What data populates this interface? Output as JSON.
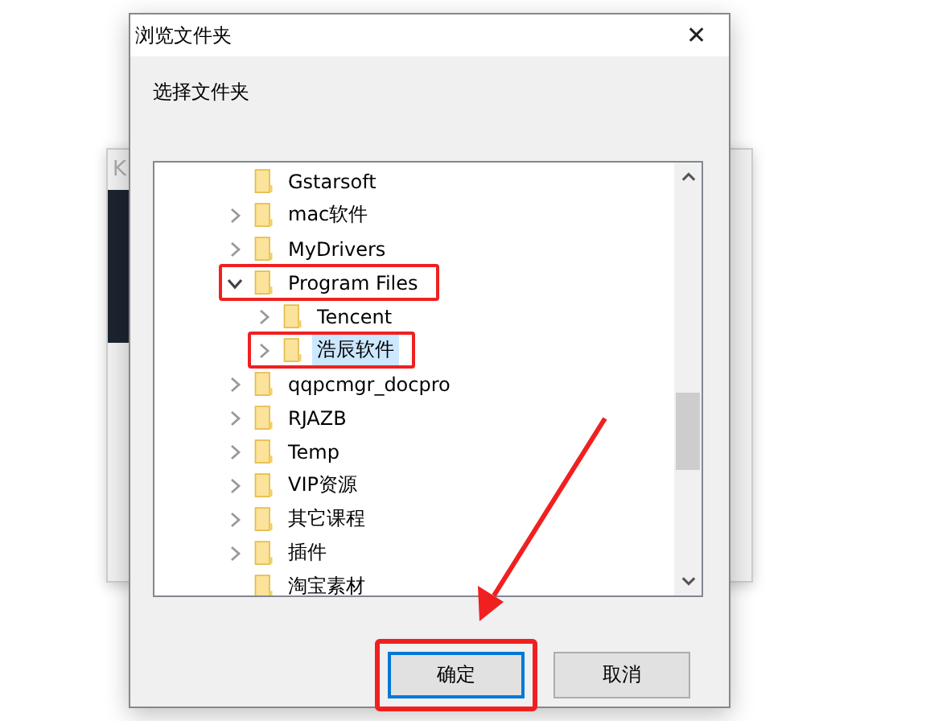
{
  "background_window": {
    "title": "K"
  },
  "window": {
    "title": "浏览文件夹",
    "close": "✕"
  },
  "prompt": "选择文件夹",
  "tree": [
    {
      "label": "Gstarsoft",
      "has_children": false,
      "selected": false,
      "highlighted": false
    },
    {
      "label": "mac软件",
      "has_children": true,
      "expanded": false,
      "selected": false,
      "highlighted": false
    },
    {
      "label": "MyDrivers",
      "has_children": true,
      "expanded": false,
      "selected": false,
      "highlighted": false
    },
    {
      "label": "Program Files",
      "has_children": true,
      "expanded": true,
      "selected": false,
      "highlighted": true,
      "children": [
        {
          "label": "Tencent",
          "has_children": true,
          "expanded": false,
          "selected": false,
          "highlighted": false
        },
        {
          "label": "浩辰软件",
          "has_children": true,
          "expanded": false,
          "selected": true,
          "highlighted": true
        }
      ]
    },
    {
      "label": "qqpcmgr_docpro",
      "has_children": true,
      "expanded": false,
      "selected": false,
      "highlighted": false
    },
    {
      "label": "RJAZB",
      "has_children": true,
      "expanded": false,
      "selected": false,
      "highlighted": false
    },
    {
      "label": "Temp",
      "has_children": true,
      "expanded": false,
      "selected": false,
      "highlighted": false
    },
    {
      "label": "VIP资源",
      "has_children": true,
      "expanded": false,
      "selected": false,
      "highlighted": false
    },
    {
      "label": "其它课程",
      "has_children": true,
      "expanded": false,
      "selected": false,
      "highlighted": false
    },
    {
      "label": "插件",
      "has_children": true,
      "expanded": false,
      "selected": false,
      "highlighted": false
    },
    {
      "label": "淘宝素材",
      "has_children": false,
      "selected": false,
      "highlighted": false
    }
  ],
  "buttons": [
    {
      "label": "确定",
      "default": true,
      "highlighted": true
    },
    {
      "label": "取消",
      "default": false,
      "highlighted": false
    }
  ]
}
